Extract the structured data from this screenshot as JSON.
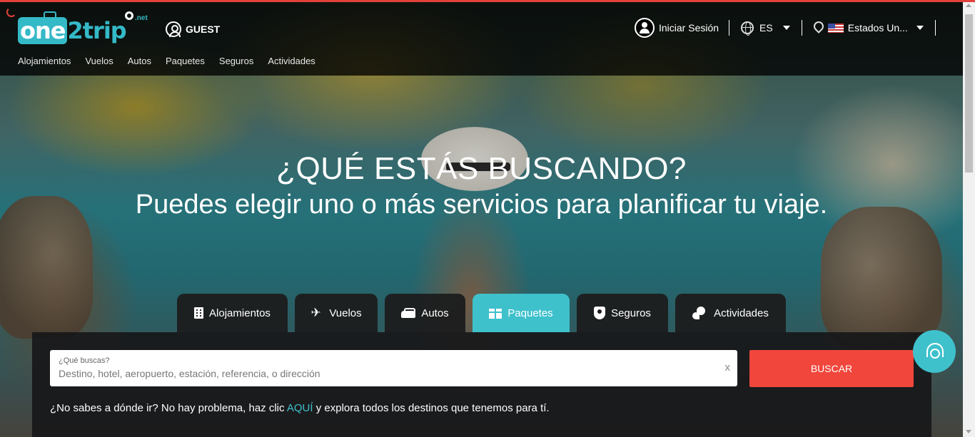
{
  "brand": {
    "logo_text_one": "one",
    "logo_text_two": "2",
    "logo_text_trip": "trip",
    "logo_suffix": ".net",
    "accent": "#3fc1cc",
    "cta": "#f1463c"
  },
  "header": {
    "guest_label": "GUEST",
    "nav": [
      "Alojamientos",
      "Vuelos",
      "Autos",
      "Paquetes",
      "Seguros",
      "Actividades"
    ],
    "login_label": "Iniciar Sesión",
    "language": "ES",
    "country": "Estados Un..."
  },
  "hero": {
    "title": "¿QUÉ ESTÁS BUSCANDO?",
    "subtitle": "Puedes elegir uno o más servicios para planificar tu viaje."
  },
  "tabs": [
    {
      "label": "Alojamientos",
      "icon": "building-icon"
    },
    {
      "label": "Vuelos",
      "icon": "plane-icon"
    },
    {
      "label": "Autos",
      "icon": "car-icon"
    },
    {
      "label": "Paquetes",
      "icon": "gift-icon",
      "active": true
    },
    {
      "label": "Seguros",
      "icon": "shield-icon"
    },
    {
      "label": "Actividades",
      "icon": "activities-icon"
    }
  ],
  "search": {
    "label": "¿Qué buscas?",
    "placeholder": "Destino, hotel, aeropuerto, estación, referencia, o dirección",
    "value": "",
    "clear_label": "x",
    "button_label": "BUSCAR"
  },
  "hint": {
    "before": "¿No sabes a dónde ir? No hay problema, haz clic ",
    "link": "AQUÍ",
    "after": " y explora todos los destinos que tenemos para tí."
  }
}
